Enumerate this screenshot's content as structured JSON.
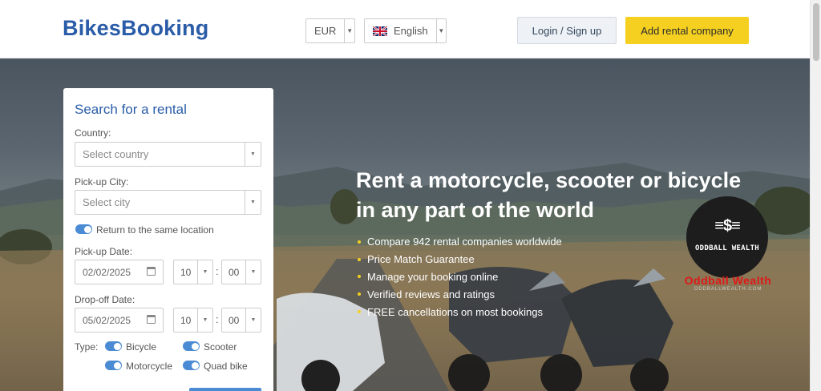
{
  "header": {
    "logo": "BikesBooking",
    "currency": "EUR",
    "language": "English",
    "login_label": "Login / Sign up",
    "add_company_label": "Add rental company"
  },
  "hero": {
    "title_line1": "Rent a motorcycle, scooter or bicycle",
    "title_line2": "in any part of the world",
    "benefits": [
      "Compare 942 rental companies worldwide",
      "Price Match Guarantee",
      "Manage your booking online",
      "Verified reviews and ratings",
      "FREE cancellations on most bookings"
    ]
  },
  "watermark": {
    "badge_icon": "$",
    "badge_text": "ODDBALL WEALTH",
    "title": "Oddball Wealth",
    "subtitle": "ODDBALLWEALTH.COM"
  },
  "search": {
    "title": "Search for a rental",
    "country_label": "Country:",
    "country_placeholder": "Select country",
    "city_label": "Pick-up City:",
    "city_placeholder": "Select city",
    "return_same_label": "Return to the same location",
    "pickup_date_label": "Pick-up Date:",
    "pickup_date": "02/02/2025",
    "pickup_hour": "10",
    "pickup_minute": "00",
    "dropoff_date_label": "Drop-off Date:",
    "dropoff_date": "05/02/2025",
    "dropoff_hour": "10",
    "dropoff_minute": "00",
    "type_label": "Type:",
    "types": [
      "Bicycle",
      "Scooter",
      "Motorcycle",
      "Quad bike"
    ]
  },
  "colors": {
    "brand_blue": "#2a5ca8",
    "accent_yellow": "#f5d020",
    "toggle_blue": "#4a8bd4"
  }
}
